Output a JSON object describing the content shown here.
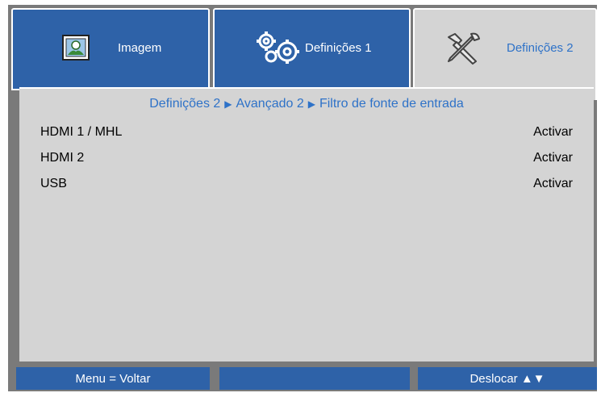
{
  "tabs": [
    {
      "label": "Imagem",
      "icon": "image-settings-icon",
      "active": false
    },
    {
      "label": "Definições 1",
      "icon": "gears-icon",
      "active": false
    },
    {
      "label": "Definições 2",
      "icon": "tools-icon",
      "active": true
    }
  ],
  "breadcrumb": {
    "part1": "Definições 2",
    "part2": "Avançado 2",
    "part3": "Filtro de fonte de entrada",
    "separator": "▶"
  },
  "rows": [
    {
      "label": "HDMI 1 / MHL",
      "value": "Activar"
    },
    {
      "label": "HDMI 2",
      "value": "Activar"
    },
    {
      "label": "USB",
      "value": "Activar"
    }
  ],
  "footer": {
    "left": "Menu = Voltar",
    "middle": "",
    "right": "Deslocar ▲▼"
  },
  "colors": {
    "tab_blue": "#2e62a8",
    "panel_gray": "#d4d4d4",
    "accent_text": "#2e72c8",
    "frame_gray": "#7a7a7a"
  }
}
